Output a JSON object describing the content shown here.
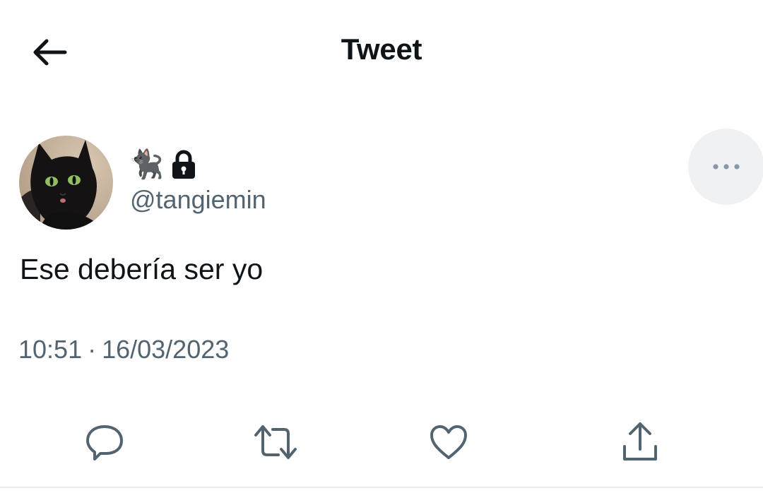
{
  "header": {
    "title": "Tweet",
    "back_icon": "arrow-left-icon"
  },
  "user": {
    "name_emoji": "🐈‍⬛",
    "locked_icon": "lock-icon",
    "handle": "@tangiemin",
    "avatar": "black-cat-avatar"
  },
  "more_icon": "more-horizontal-icon",
  "tweet": {
    "text": "Ese debería ser yo",
    "time": "10:51",
    "separator": "·",
    "date": "16/03/2023"
  },
  "actions": {
    "reply_icon": "reply-icon",
    "retweet_icon": "retweet-icon",
    "like_icon": "heart-icon",
    "share_icon": "share-icon"
  },
  "colors": {
    "text": "#0f1419",
    "secondary": "#536471",
    "more_bg": "#eff1f3"
  }
}
